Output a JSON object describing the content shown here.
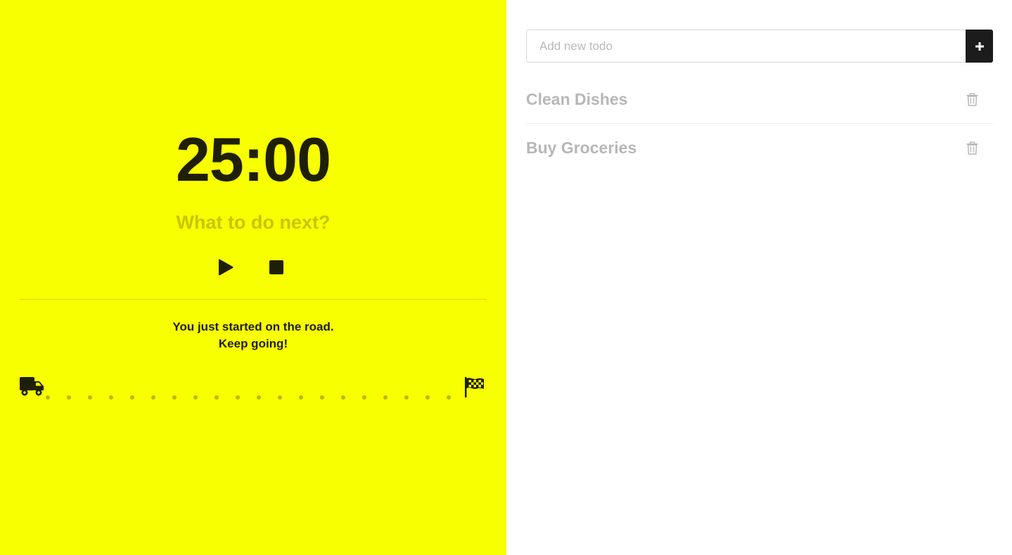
{
  "timer": {
    "time": "25:00",
    "next_task": "What to do next?",
    "play_icon": "play-icon",
    "stop_icon": "stop-icon"
  },
  "road": {
    "message_line1": "You just started on the road.",
    "message_line2": "Keep going!",
    "start_icon": "truck-icon",
    "end_icon": "checkered-flag-icon",
    "progress": 0,
    "dot_count": 20
  },
  "todo": {
    "input_placeholder": "Add new todo",
    "input_value": "",
    "add_icon": "plus-icon",
    "items": [
      {
        "label": "Clean Dishes",
        "delete_icon": "trash-icon"
      },
      {
        "label": "Buy Groceries",
        "delete_icon": "trash-icon"
      }
    ]
  },
  "colors": {
    "timer_background": "#f8ff00",
    "timer_text": "#1f1f06",
    "muted_yellow": "#c5c600",
    "todo_text": "#b7b7b7",
    "add_button": "#1c1c1c"
  }
}
